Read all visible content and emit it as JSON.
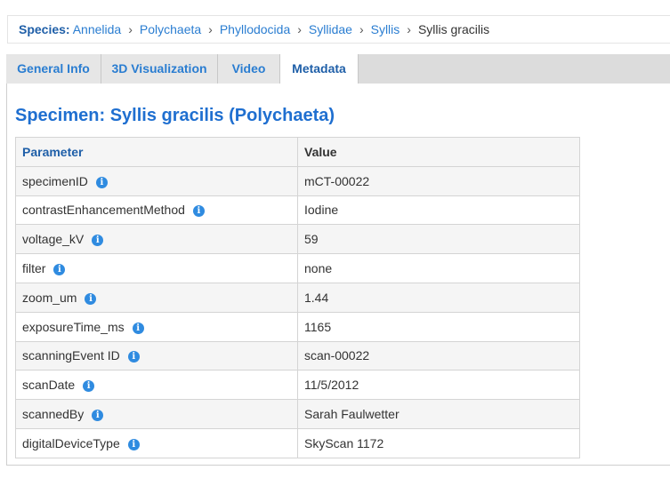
{
  "breadcrumb": {
    "label": "Species:",
    "links": [
      "Annelida",
      "Polychaeta",
      "Phyllodocida",
      "Syllidae",
      "Syllis"
    ],
    "separator": "›",
    "current": "Syllis gracilis"
  },
  "tabs": [
    {
      "label": "General Info"
    },
    {
      "label": "3D Visualization"
    },
    {
      "label": "Video"
    },
    {
      "label": "Metadata",
      "active": true
    }
  ],
  "main": {
    "title": "Specimen: Syllis gracilis (Polychaeta)",
    "info_icon": "info-icon",
    "table": {
      "headers": [
        "Parameter",
        "Value"
      ],
      "rows": [
        {
          "param": "specimenID",
          "value": "mCT-00022"
        },
        {
          "param": "contrastEnhancementMethod",
          "value": "Iodine"
        },
        {
          "param": "voltage_kV",
          "value": "59"
        },
        {
          "param": "filter",
          "value": "none"
        },
        {
          "param": "zoom_um",
          "value": "1.44"
        },
        {
          "param": "exposureTime_ms",
          "value": "1165"
        },
        {
          "param": "scanningEvent ID",
          "value": "scan-00022"
        },
        {
          "param": "scanDate",
          "value": "11/5/2012"
        },
        {
          "param": "scannedBy",
          "value": "Sarah Faulwetter"
        },
        {
          "param": "digitalDeviceType",
          "value": "SkyScan 1172"
        }
      ]
    }
  },
  "colors": {
    "link": "#2a7dd1",
    "title": "#1f6fd0",
    "info_icon": "#2f8be0",
    "tab_bar": "#dcdcdc"
  }
}
